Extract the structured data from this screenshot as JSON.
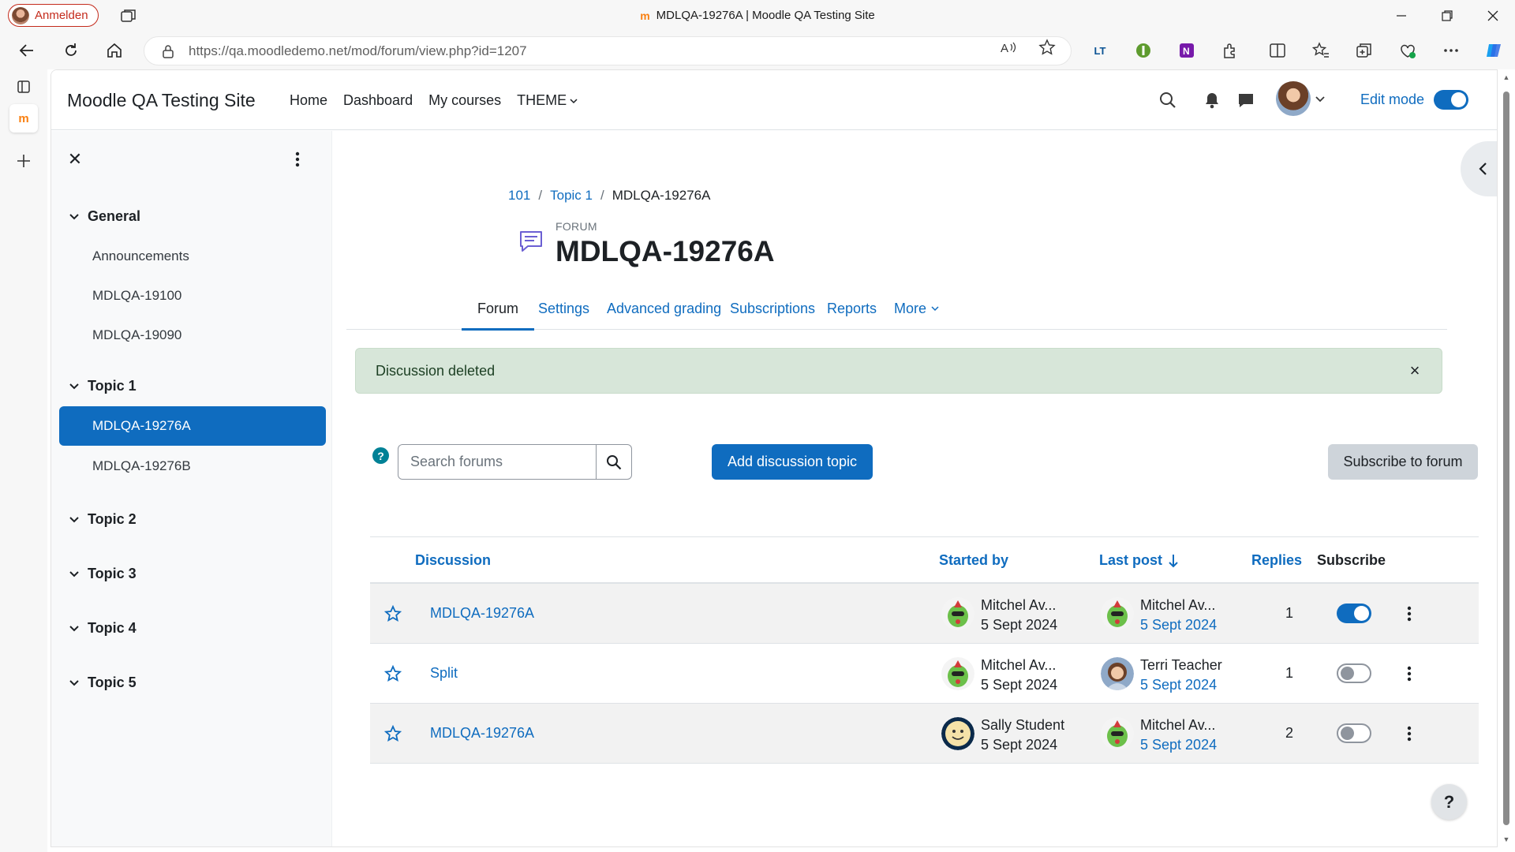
{
  "browser": {
    "profile_label": "Anmelden",
    "tab_title": "MDLQA-19276A | Moodle QA Testing Site",
    "url": "https://qa.moodledemo.net/mod/forum/view.php?id=1207",
    "favicon_text": "m"
  },
  "site": {
    "name": "Moodle QA Testing Site",
    "primary_nav": [
      "Home",
      "Dashboard",
      "My courses",
      "THEME"
    ],
    "edit_mode_label": "Edit mode",
    "edit_mode_on": true
  },
  "course_index": {
    "sections": [
      {
        "title": "General",
        "items": [
          "Announcements",
          "MDLQA-19100",
          "MDLQA-19090"
        ]
      },
      {
        "title": "Topic 1",
        "items": [
          "MDLQA-19276A",
          "MDLQA-19276B"
        ],
        "active_item": "MDLQA-19276A"
      },
      {
        "title": "Topic 2",
        "items": []
      },
      {
        "title": "Topic 3",
        "items": []
      },
      {
        "title": "Topic 4",
        "items": []
      },
      {
        "title": "Topic 5",
        "items": []
      }
    ]
  },
  "breadcrumb": [
    "101",
    "Topic 1",
    "MDLQA-19276A"
  ],
  "activity": {
    "type_label": "FORUM",
    "title": "MDLQA-19276A"
  },
  "secondary_nav": {
    "tabs": [
      "Forum",
      "Settings",
      "Advanced grading",
      "Subscriptions",
      "Reports",
      "More"
    ],
    "active": "Forum"
  },
  "alert": {
    "message": "Discussion deleted"
  },
  "toolbar": {
    "search_placeholder": "Search forums",
    "add_discussion_label": "Add discussion topic",
    "subscribe_label": "Subscribe to forum"
  },
  "discussions": {
    "headers": {
      "discussion": "Discussion",
      "started_by": "Started by",
      "last_post": "Last post",
      "replies": "Replies",
      "subscribe": "Subscribe"
    },
    "rows": [
      {
        "title": "MDLQA-19276A",
        "started_by": "Mitchel Av...",
        "started_date": "5 Sept 2024",
        "last_by": "Mitchel Av...",
        "last_date": "5 Sept 2024",
        "replies": "1",
        "subscribed": true,
        "starter_avatar": "robot-avatar",
        "last_avatar": "robot-avatar"
      },
      {
        "title": "Split",
        "started_by": "Mitchel Av...",
        "started_date": "5 Sept 2024",
        "last_by": "Terri Teacher",
        "last_date": "5 Sept 2024",
        "replies": "1",
        "subscribed": false,
        "starter_avatar": "robot-avatar",
        "last_avatar": "photo-avatar"
      },
      {
        "title": "MDLQA-19276A",
        "started_by": "Sally Student",
        "started_date": "5 Sept 2024",
        "last_by": "Mitchel Av...",
        "last_date": "5 Sept 2024",
        "replies": "2",
        "subscribed": false,
        "starter_avatar": "smiley-avatar",
        "last_avatar": "robot-avatar"
      }
    ]
  },
  "footer": {
    "help_label": "?"
  },
  "colors": {
    "brand": "#0f6cbf",
    "alert_bg": "#d7e6d9",
    "help_teal": "#008196"
  }
}
